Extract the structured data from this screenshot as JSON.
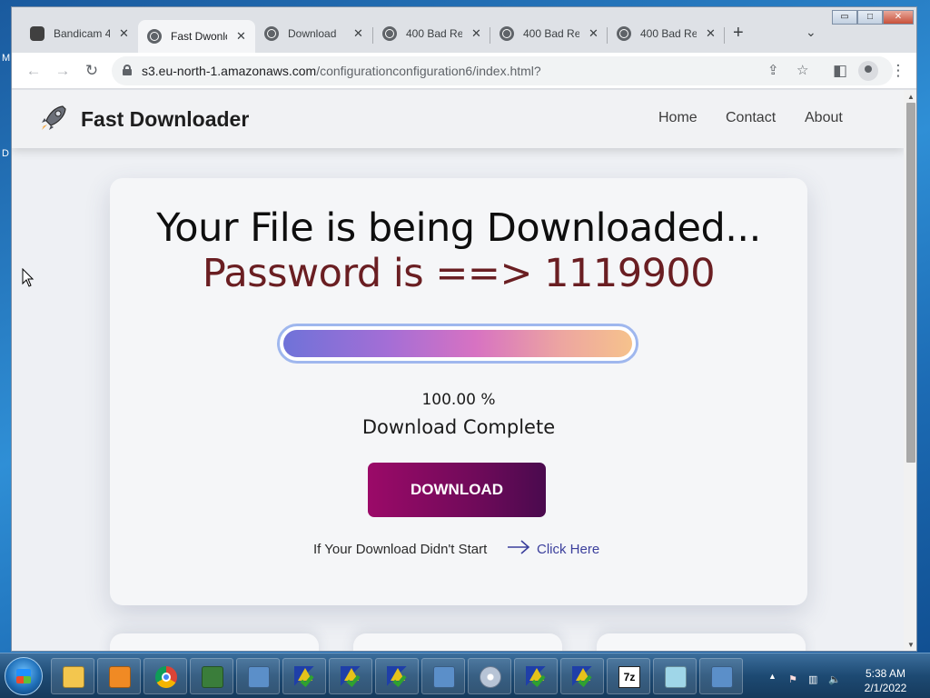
{
  "desktop": {
    "labels": [
      "M",
      "D"
    ]
  },
  "browser": {
    "tabs": [
      {
        "title": "Bandicam 4",
        "icon": "bandicam-icon",
        "active": false
      },
      {
        "title": "Fast Dwonlo",
        "icon": "globe-icon",
        "active": true
      },
      {
        "title": "Download",
        "icon": "globe-icon",
        "active": false
      },
      {
        "title": "400 Bad Re",
        "icon": "globe-icon",
        "active": false
      },
      {
        "title": "400 Bad Re",
        "icon": "globe-icon",
        "active": false
      },
      {
        "title": "400 Bad Re",
        "icon": "globe-icon",
        "active": false
      }
    ],
    "close_glyph": "✕",
    "new_tab_glyph": "+",
    "tab_menu_glyph": "⌄",
    "window_controls": [
      "▭",
      "□",
      "✕"
    ],
    "nav_glyphs": {
      "back": "←",
      "forward": "→",
      "reload": "↻"
    },
    "url_host": "s3.eu-north-1.amazonaws.com",
    "url_path": "/configurationconfiguration6/index.html?",
    "omnibox_icons": {
      "share": "⇪",
      "bookmark": "☆",
      "sidepanel": "◧",
      "menu": "⋮"
    }
  },
  "site": {
    "brand": "Fast Downloader",
    "nav": [
      "Home",
      "Contact",
      "About"
    ],
    "heading": "Your File is being Downloaded...",
    "password_line": "Password is ==> 1119900",
    "progress_percent": 100,
    "percent_text": "100.00 %",
    "status_text": "Download Complete",
    "download_button": "DOWNLOAD",
    "hint_text": "If Your Download Didn't Start",
    "hint_link": "Click Here",
    "colors": {
      "password": "#6a1e22",
      "button_start": "#9b0a68",
      "button_end": "#4a0a4e",
      "link": "#3b3f9c"
    }
  },
  "taskbar": {
    "apps": [
      "folder-icon",
      "media-player-icon",
      "chrome-icon",
      "task-manager-icon",
      "network-icon",
      "warning-check-icon",
      "warning-check-icon",
      "warning-check-icon",
      "network-icon",
      "disc-icon",
      "warning-check-icon",
      "warning-check-icon",
      "7zip-icon",
      "notepad-icon",
      "network-icon"
    ],
    "zip_label": "7z",
    "tray_arrow": "▲",
    "tray_glyphs": [
      "⚑",
      "▥",
      "🔈"
    ],
    "time": "5:38 AM",
    "date": "2/1/2022"
  }
}
